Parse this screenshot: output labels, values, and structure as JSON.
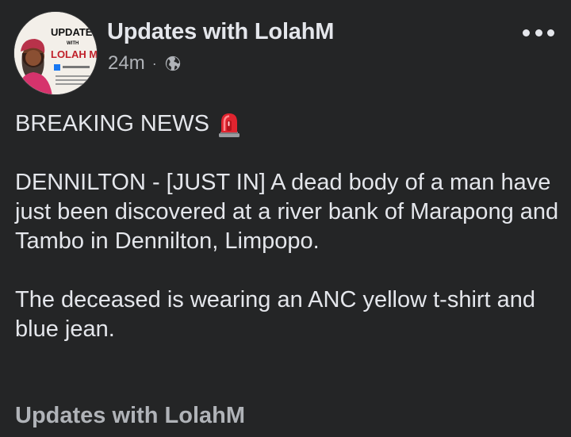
{
  "post": {
    "page_name": "Updates with LolahM",
    "time": "24m",
    "separator": "·",
    "privacy_icon": "globe-icon",
    "menu_icon": "more-horizontal-icon",
    "avatar": {
      "logo_line1": "UPDATE",
      "logo_line2": "WITH",
      "logo_line3": "LOLAH M"
    },
    "headline": "BREAKING NEWS",
    "headline_emoji": "siren-icon",
    "paragraph1": "DENNILTON - [JUST IN] A dead body of a man have just been discovered at a river bank of Marapong and Tambo in Dennilton, Limpopo.",
    "paragraph2": "The deceased is wearing an ANC yellow t-shirt and blue jean.",
    "footer_name": "Updates with LolahM"
  },
  "colors": {
    "background": "#242526",
    "primary_text": "#e4e6eb",
    "secondary_text": "#b0b3b8",
    "siren_red": "#e0242f"
  }
}
